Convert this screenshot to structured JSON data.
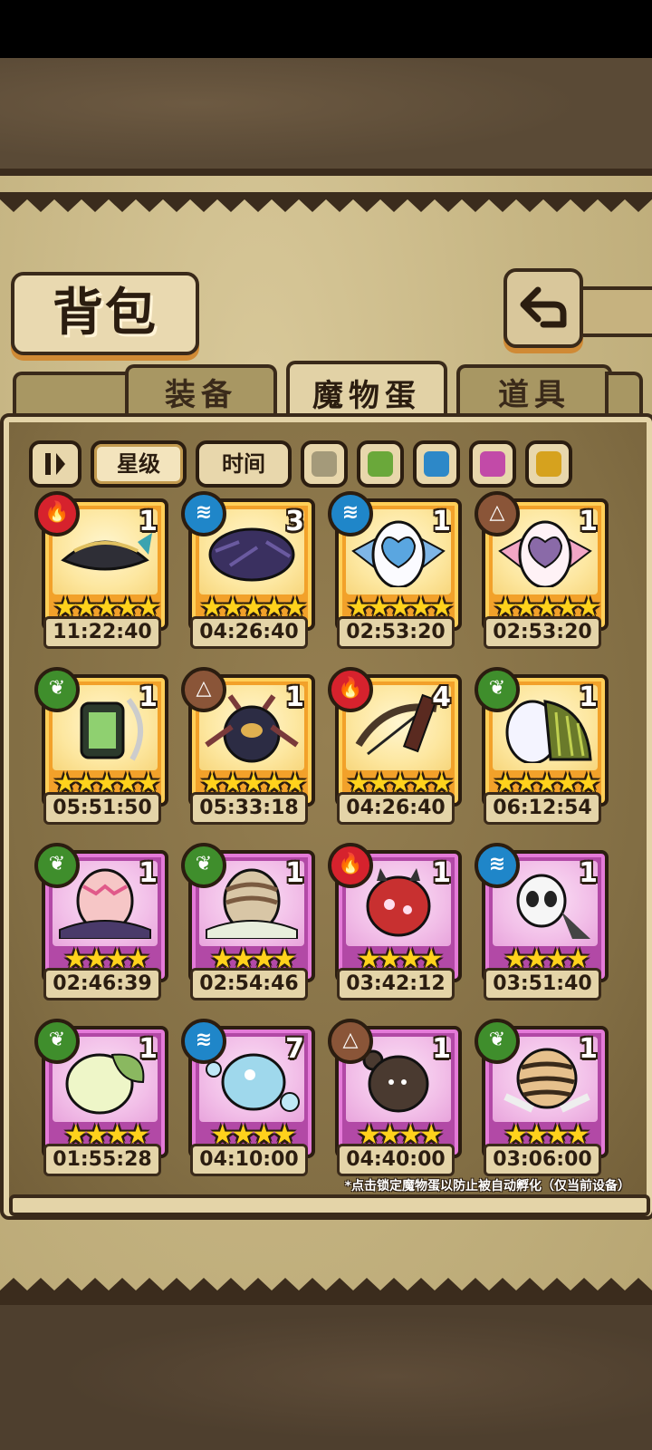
{
  "title": "背包",
  "back_icon": "back-arrow-icon",
  "tabs": [
    {
      "label": "装备",
      "active": false
    },
    {
      "label": "魔物蛋",
      "active": true
    },
    {
      "label": "道具",
      "active": false
    }
  ],
  "sort": {
    "toggle_icon": "sort-toggle-icon",
    "star_label": "星级",
    "time_label": "时间"
  },
  "color_filters": [
    {
      "name": "gray",
      "color": "#a49a7a"
    },
    {
      "name": "green",
      "color": "#6aa83a"
    },
    {
      "name": "blue",
      "color": "#2d88c8"
    },
    {
      "name": "pink",
      "color": "#c24aa8"
    },
    {
      "name": "yellow",
      "color": "#d6a21e"
    }
  ],
  "eggs": [
    {
      "element": "fire",
      "element_icon": "fire-icon",
      "count": "1",
      "stars": "★★★★★",
      "timer": "11:22:40",
      "rarity": "gold",
      "art": "pirate-hat-egg"
    },
    {
      "element": "water",
      "element_icon": "water-icon",
      "count": "3",
      "stars": "★★★★★",
      "timer": "04:26:40",
      "rarity": "gold",
      "art": "feather-egg"
    },
    {
      "element": "water",
      "element_icon": "water-icon",
      "count": "1",
      "stars": "★★★★★",
      "timer": "02:53:20",
      "rarity": "gold",
      "art": "heart-bow-egg-blue"
    },
    {
      "element": "earth",
      "element_icon": "earth-icon",
      "count": "1",
      "stars": "★★★★★",
      "timer": "02:53:20",
      "rarity": "gold",
      "art": "heart-bow-egg-pink"
    },
    {
      "element": "grass",
      "element_icon": "grass-icon",
      "count": "1",
      "stars": "★★★★★",
      "timer": "05:51:50",
      "rarity": "gold",
      "art": "lantern-egg"
    },
    {
      "element": "earth",
      "element_icon": "earth-icon",
      "count": "1",
      "stars": "★★★★★",
      "timer": "05:33:18",
      "rarity": "gold",
      "art": "beetle-egg"
    },
    {
      "element": "fire",
      "element_icon": "fire-icon",
      "count": "4",
      "stars": "★★★★★",
      "timer": "04:26:40",
      "rarity": "gold",
      "art": "quiver-egg"
    },
    {
      "element": "grass",
      "element_icon": "grass-icon",
      "count": "1",
      "stars": "★★★★★",
      "timer": "06:12:54",
      "rarity": "gold",
      "art": "wing-egg"
    },
    {
      "element": "grass",
      "element_icon": "grass-icon",
      "count": "1",
      "stars": "★★★★",
      "timer": "02:46:39",
      "rarity": "purple",
      "art": "nest-egg-pink"
    },
    {
      "element": "grass",
      "element_icon": "grass-icon",
      "count": "1",
      "stars": "★★★★",
      "timer": "02:54:46",
      "rarity": "purple",
      "art": "nest-egg-brown"
    },
    {
      "element": "fire",
      "element_icon": "fire-icon",
      "count": "1",
      "stars": "★★★★",
      "timer": "03:42:12",
      "rarity": "purple",
      "art": "red-horn-egg"
    },
    {
      "element": "water",
      "element_icon": "water-icon",
      "count": "1",
      "stars": "★★★★",
      "timer": "03:51:40",
      "rarity": "purple",
      "art": "panda-egg"
    },
    {
      "element": "grass",
      "element_icon": "grass-icon",
      "count": "1",
      "stars": "★★★★",
      "timer": "01:55:28",
      "rarity": "purple",
      "art": "leaf-egg"
    },
    {
      "element": "water",
      "element_icon": "water-icon",
      "count": "7",
      "stars": "★★★★",
      "timer": "04:10:00",
      "rarity": "purple",
      "art": "bubble-egg"
    },
    {
      "element": "earth",
      "element_icon": "earth-icon",
      "count": "1",
      "stars": "★★★★",
      "timer": "04:40:00",
      "rarity": "purple",
      "art": "bear-egg"
    },
    {
      "element": "grass",
      "element_icon": "grass-icon",
      "count": "1",
      "stars": "★★★★",
      "timer": "03:06:00",
      "rarity": "purple",
      "art": "tiger-egg"
    }
  ],
  "footnote": "*点击锁定魔物蛋以防止被自动孵化（仅当前设备）"
}
